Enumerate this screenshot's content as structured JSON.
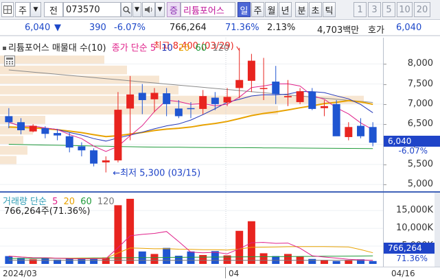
{
  "toolbar": {
    "code_prefix": "주",
    "market_label": "전",
    "code": "073570",
    "stock_name": "리튬포어스",
    "prefix_badge": "증",
    "period_buttons": [
      "일",
      "주",
      "월",
      "년",
      "분",
      "초",
      "틱"
    ],
    "selected_period": "일",
    "minute_buttons": [
      "1",
      "3",
      "5",
      "10",
      "20"
    ]
  },
  "quote": {
    "price": "6,040",
    "direction": "▼",
    "change": "390",
    "change_pct": "-6.07%",
    "volume": "766,264",
    "volume_ratio": "71.36%",
    "turnover": "2.13%",
    "trade_value": "4,703백만",
    "bid_label": "호가",
    "bid_price": "6,040"
  },
  "price_chart": {
    "legend_title": "리튬포어스 매물대 수(10)",
    "legend_ma_label": "종가 단순",
    "legend_ma": [
      "5",
      "10",
      "20",
      "60",
      "120"
    ],
    "ma_colors": {
      "5": "#e0218a",
      "10": "#2236b8",
      "20": "#e8a200",
      "60": "#1f9a3a",
      "120": "#777777"
    },
    "high_label": "최고 8,400 (03/29)",
    "low_label": "최저 5,300 (03/15)",
    "y_ticks": [
      "8,000",
      "7,500",
      "7,000",
      "6,500",
      "6,000",
      "5,500",
      "5,000"
    ],
    "current_price_tag": "6,040",
    "current_change_tag": "-6.07%"
  },
  "volume_chart": {
    "legend_title": "거래량 단순",
    "legend_ma": [
      "5",
      "20",
      "60",
      "120"
    ],
    "volume_text": "766,264주(71.36%)",
    "y_ticks": [
      "15,000K",
      "10,000K",
      "5,000K"
    ],
    "current_volume_tag": "766,264",
    "current_ratio_tag": "71.36%"
  },
  "dates": {
    "start": "2024/03",
    "month_mark": "04",
    "end": "04/16"
  },
  "colors": {
    "up": "#e8241f",
    "down": "#1f55d1",
    "accent": "#3f62b8"
  },
  "chart_data": {
    "type": "candlestick",
    "dates": [
      "03/04",
      "03/05",
      "03/06",
      "03/07",
      "03/08",
      "03/11",
      "03/12",
      "03/13",
      "03/14",
      "03/15",
      "03/18",
      "03/19",
      "03/20",
      "03/21",
      "03/22",
      "03/25",
      "03/26",
      "03/27",
      "03/28",
      "03/29",
      "04/01",
      "04/02",
      "04/03",
      "04/04",
      "04/05",
      "04/08",
      "04/09",
      "04/11",
      "04/12",
      "04/15",
      "04/16"
    ],
    "open": [
      6700,
      6550,
      6320,
      6400,
      6280,
      6200,
      5950,
      5850,
      5550,
      5600,
      6890,
      7280,
      7120,
      7270,
      6890,
      6900,
      6880,
      7160,
      7040,
      7400,
      7580,
      7400,
      7560,
      7170,
      7050,
      7310,
      6900,
      7000,
      6180,
      6460,
      6430
    ],
    "high": [
      6900,
      6650,
      6500,
      6450,
      6380,
      6300,
      6050,
      5900,
      5700,
      7300,
      7700,
      7500,
      7400,
      7400,
      7100,
      7050,
      7350,
      7300,
      7400,
      8400,
      8250,
      8150,
      7950,
      7600,
      7400,
      7400,
      7100,
      7100,
      6550,
      6650,
      6550
    ],
    "low": [
      6400,
      6250,
      6300,
      6150,
      6100,
      5800,
      5700,
      5450,
      5300,
      5550,
      6100,
      6750,
      6800,
      6700,
      6650,
      6650,
      6750,
      6850,
      6950,
      7150,
      7300,
      7100,
      7000,
      6950,
      7000,
      6850,
      6700,
      6900,
      6100,
      6150,
      5950
    ],
    "close": [
      6550,
      6350,
      6460,
      6260,
      6220,
      5920,
      5850,
      5520,
      5600,
      6860,
      7240,
      7100,
      7280,
      7000,
      6700,
      6890,
      7200,
      7000,
      7180,
      7600,
      8080,
      7400,
      7250,
      7200,
      7320,
      6880,
      6950,
      6200,
      6430,
      6200,
      6040
    ],
    "volume": [
      2200,
      1700,
      1300,
      1700,
      1200,
      1500,
      1500,
      1400,
      1800,
      16500,
      18300,
      3500,
      2800,
      4500,
      2300,
      3500,
      2500,
      3600,
      2400,
      9300,
      12000,
      3000,
      2200,
      2800,
      2100,
      1400,
      1100,
      800,
      1100,
      1300,
      800
    ],
    "volume_unit": "K",
    "ylim": [
      4900,
      8550
    ],
    "volume_ylim": [
      0,
      18500
    ]
  }
}
